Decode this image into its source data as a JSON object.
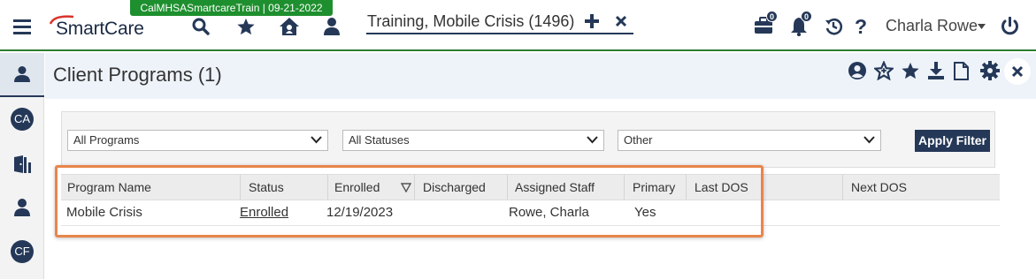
{
  "header": {
    "environment_badge": "CalMHSASmartcareTrain | 09-21-2022",
    "logo_text": "SmartCare",
    "client_tab": "Training, Mobile Crisis (1496)",
    "briefcase_count": "0",
    "notification_count": "0",
    "user_name": "Charla Rowe"
  },
  "sidebar": {
    "items": [
      {
        "label": ""
      },
      {
        "label": "CA"
      },
      {
        "label": ""
      },
      {
        "label": ""
      },
      {
        "label": "CF"
      }
    ]
  },
  "page": {
    "title": "Client Programs (1)"
  },
  "filters": {
    "program": "All Programs",
    "status": "All Statuses",
    "other": "Other",
    "apply_label": "Apply Filter"
  },
  "grid": {
    "columns": [
      "Program Name",
      "Status",
      "Enrolled",
      "Discharged",
      "Assigned Staff",
      "Primary",
      "Last DOS",
      "Next DOS"
    ],
    "rows": [
      {
        "program_name": "Mobile Crisis",
        "status": "Enrolled",
        "enrolled": "12/19/2023",
        "discharged": "",
        "assigned_staff": "Rowe, Charla",
        "primary": "Yes",
        "last_dos": "",
        "next_dos": ""
      }
    ]
  },
  "colors": {
    "brand_navy": "#253858",
    "env_green": "#1e8f2e",
    "highlight_orange": "#e8854a",
    "logo_red": "#d9342b"
  }
}
